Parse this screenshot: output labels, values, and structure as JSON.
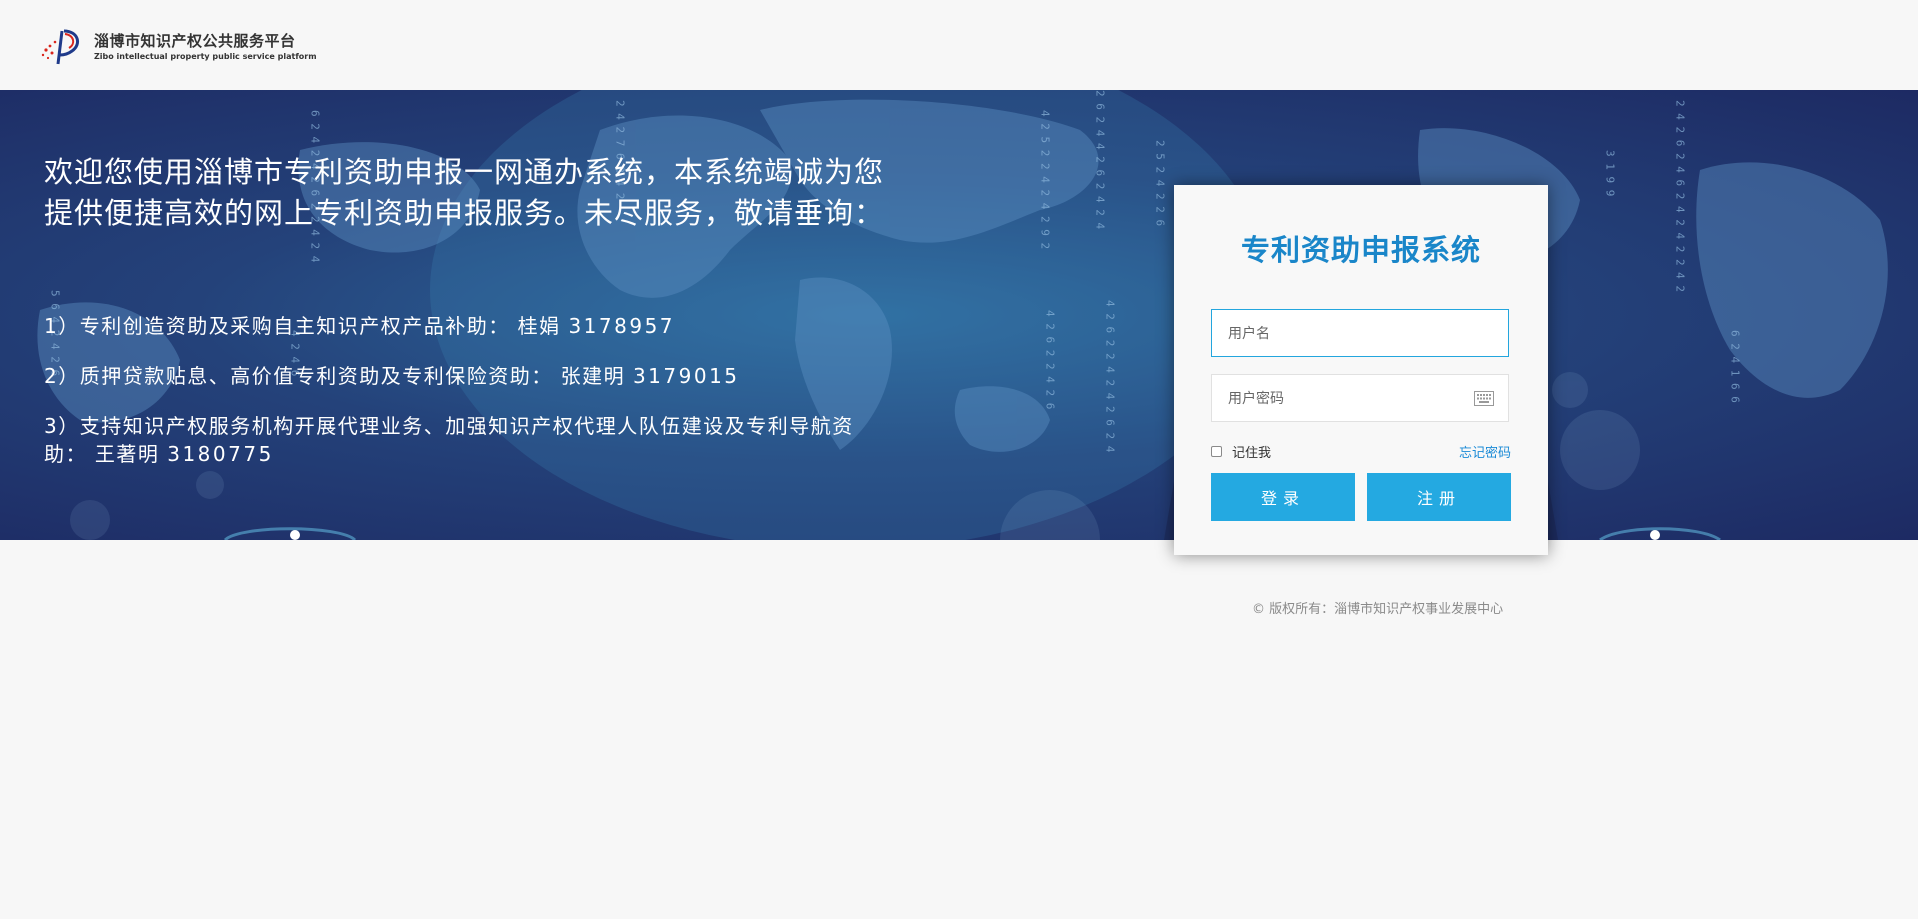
{
  "header": {
    "logo_cn": "淄博市知识产权公共服务平台",
    "logo_en": "Zibo intellectual property public service platform"
  },
  "banner": {
    "welcome": "欢迎您使用淄博市专利资助申报一网通办系统，本系统竭诚为您提供便捷高效的网上专利资助申报服务。未尽服务，敬请垂询：",
    "contacts": [
      {
        "text": "1）专利创造资助及采购自主知识产权产品补助：",
        "person": "桂娟",
        "phone": "3178957"
      },
      {
        "text": "2）质押贷款贴息、高价值专利资助及专利保险资助：",
        "person": "张建明",
        "phone": "3179015"
      },
      {
        "text": "3）支持知识产权服务机构开展代理业务、加强知识产权代理人队伍建设及专利导航资助：",
        "person": "王著明",
        "phone": "3180775"
      }
    ]
  },
  "login": {
    "title": "专利资助申报系统",
    "username_placeholder": "用户名",
    "password_placeholder": "用户密码",
    "remember_label": "记住我",
    "forgot_label": "忘记密码",
    "login_label": "登录",
    "register_label": "注册"
  },
  "footer": {
    "copyright": "© 版权所有：淄博市知识产权事业发展中心"
  },
  "colors": {
    "accent": "#24a9e1",
    "title": "#1a86c9",
    "banner_dark": "#1d2a63"
  }
}
